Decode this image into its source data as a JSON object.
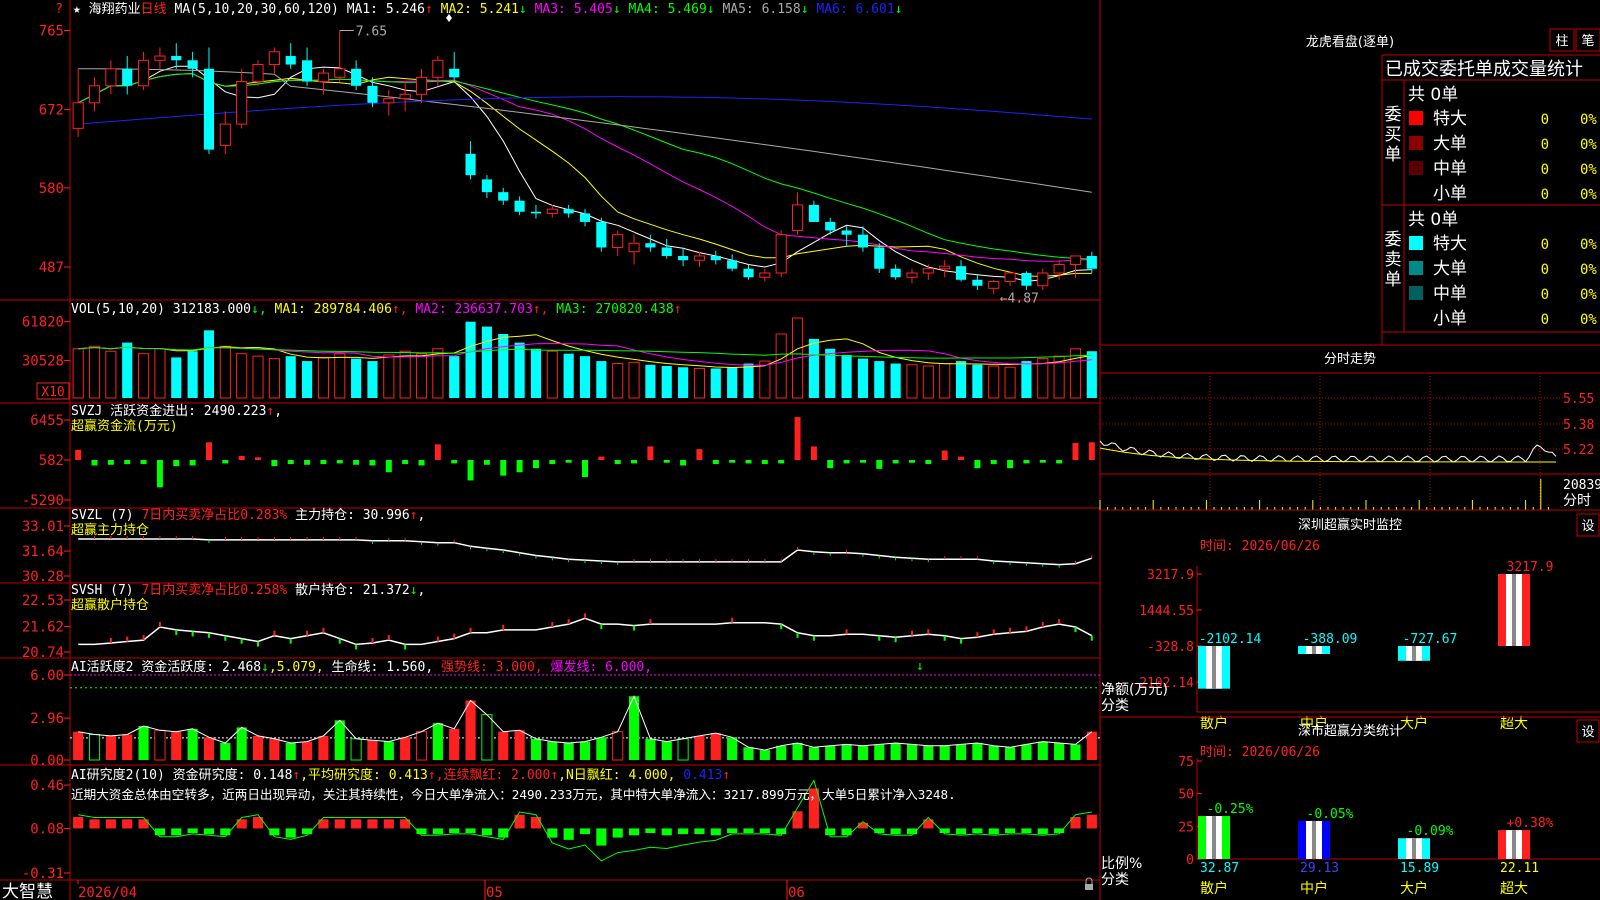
{
  "colors": {
    "bg": "#000000",
    "frame": "#c00000",
    "up": "#ff2020",
    "down": "#00ffff",
    "green": "#00ff00",
    "yellow": "#ffff00",
    "magenta": "#ff00ff",
    "blue": "#2020ff",
    "white": "#ffffff",
    "gray": "#aaaaaa"
  },
  "header": {
    "star": "★",
    "stock": "海翔药业",
    "period": "日线",
    "ma_params": "MA(5,10,20,30,60,120)",
    "ma_values": [
      {
        "label": "MA1: 5.246",
        "arrow": "↑",
        "color": "#ffffff"
      },
      {
        "label": "MA2: 5.241",
        "arrow": "↓",
        "color": "#ffff00"
      },
      {
        "label": "MA3: 5.405",
        "arrow": "↓",
        "color": "#ff00ff"
      },
      {
        "label": "MA4: 5.469",
        "arrow": "↓",
        "color": "#00ff00"
      },
      {
        "label": "MA5: 6.158",
        "arrow": "↓",
        "color": "#aaaaaa"
      },
      {
        "label": "MA6: 6.601",
        "arrow": "↓",
        "color": "#2020ff"
      }
    ],
    "top_question": "?"
  },
  "panels": {
    "price": {
      "ticks": [
        "765",
        "672",
        "580",
        "487"
      ],
      "high_label": "7.65",
      "low_label": "←4.87"
    },
    "vol": {
      "header": "VOL(5,10,20)",
      "v": "312183.000",
      "v_arrow": "↓",
      "ma1": "MA1: 289784.406",
      "ma1_arrow": "↑",
      "ma2": "MA2: 236637.703",
      "ma2_arrow": "↑",
      "ma3": "MA3: 270820.438",
      "ma3_arrow": "↑",
      "ticks": [
        "61820",
        "30528"
      ],
      "unit": "X10"
    },
    "svzj": {
      "header1": "SVZJ  活跃资金进出: 2490.223",
      "arrow": "↑",
      "comma": ",",
      "header2": "超赢资金流(万元)",
      "ticks": [
        "6455",
        "582",
        "-5290"
      ]
    },
    "svzl": {
      "p1": "SVZL (7)",
      "p2": "7日内买卖净占比0.283%",
      "p3": "主力持仓: 30.996",
      "arrow": "↑",
      "comma": ",",
      "header2": "超赢主力持仓",
      "ticks": [
        "33.01",
        "31.64",
        "30.28"
      ]
    },
    "svsh": {
      "p1": "SVSH (7)",
      "p2": "7日内买卖净占比0.258%",
      "p3": "散户持仓: 21.372",
      "arrow": "↓",
      "comma": ",",
      "header2": "超赢散户持仓",
      "ticks": [
        "22.53",
        "21.62",
        "20.74"
      ]
    },
    "ai2": {
      "p1": "AI活跃度2 资金活跃度: 2.468",
      "a1": "↓",
      "p2": ",5.079,",
      "p3": "生命线: 1.560,",
      "p4": "强势线: 3.000,",
      "p5": "爆发线: 6.000,",
      "ticks": [
        "6.00",
        "2.96",
        "0.00"
      ]
    },
    "ai_research": {
      "p1": "AI研究度2(10) 资金研究度: 0.148",
      "a1": "↑",
      "p2": ",平均研究度: 0.413",
      "a2": "↑",
      "p3": ",连续飘红: 2.000",
      "a3": "↑",
      "p4": ",N日飘红: 4.000,",
      "p5": "0.413",
      "a5": "↑",
      "comment": "近期大资金总体由空转多，近两日出现异动，关注其持续性，今日大单净流入：2490.233万元，其中特大单净流入：3217.899万元，大单5日累计净入3248.",
      "ticks": [
        "0.46",
        "0.08",
        "-0.31"
      ]
    }
  },
  "date_axis": [
    "2026/04",
    "05",
    "06"
  ],
  "brand": "大智慧",
  "right": {
    "lhb": {
      "title": "龙虎看盘(逐单)",
      "btn1": "柱",
      "btn2": "笔",
      "subtitle": "已成交委托单成交量统计",
      "buy": {
        "side": "委买单",
        "total": "共 0单",
        "rows": [
          {
            "name": "特大",
            "v": "0",
            "p": "0%",
            "c": "#ff0000"
          },
          {
            "name": "大单",
            "v": "0",
            "p": "0%",
            "c": "#8b0000"
          },
          {
            "name": "中单",
            "v": "0",
            "p": "0%",
            "c": "#5a0000"
          },
          {
            "name": "小单",
            "v": "0",
            "p": "0%",
            "c": "#000000"
          }
        ]
      },
      "sell": {
        "side": "委卖单",
        "total": "共 0单",
        "rows": [
          {
            "name": "特大",
            "v": "0",
            "p": "0%",
            "c": "#00ffff"
          },
          {
            "name": "大单",
            "v": "0",
            "p": "0%",
            "c": "#008b8b"
          },
          {
            "name": "中单",
            "v": "0",
            "p": "0%",
            "c": "#006060"
          },
          {
            "name": "小单",
            "v": "0",
            "p": "0%",
            "c": "#000000"
          }
        ]
      }
    },
    "fs": {
      "title": "分时走势",
      "ticks": [
        "5.55",
        "5.38",
        "5.22"
      ],
      "vol_tick": "20839",
      "vol_label": "分时"
    },
    "monitor": {
      "title": "深圳超赢实时监控",
      "btn": "设",
      "date": "时间: 2026/06/26",
      "ticks": [
        "3217.9",
        "1444.55",
        "-328.8",
        "-2102.14"
      ],
      "ylabel": "净额(万元)",
      "xlabel": "分类",
      "cats": [
        "散户",
        "中户",
        "大户",
        "超大"
      ],
      "values": [
        -2102.14,
        -388.09,
        -727.67,
        3217.9
      ],
      "value_labels": [
        "-2102.14",
        "-388.09",
        "-727.67",
        "3217.9"
      ]
    },
    "classify": {
      "title": "深市超赢分类统计",
      "btn": "设",
      "date": "时间: 2026/06/26",
      "ticks": [
        "75",
        "50",
        "25",
        "0"
      ],
      "ylabel": "比例%",
      "xlabel": "分类",
      "cats": [
        "散户",
        "中户",
        "大户",
        "超大"
      ],
      "values": [
        32.87,
        29.13,
        15.89,
        22.11
      ],
      "value_labels": [
        "32.87",
        "29.13",
        "15.89",
        "22.11"
      ],
      "changes": [
        "-0.25%",
        "-0.05%",
        "-0.09%",
        "+0.38%"
      ]
    }
  },
  "chart_data": [
    {
      "type": "candlestick",
      "title": "海翔药业 日线",
      "series_label": "MA(5,10,20,30,60,120)",
      "ohlc": [
        [
          6.5,
          7.2,
          6.4,
          6.8
        ],
        [
          6.8,
          7.1,
          6.7,
          7.0
        ],
        [
          7.0,
          7.3,
          6.9,
          7.2
        ],
        [
          7.2,
          7.35,
          6.9,
          7.0
        ],
        [
          7.0,
          7.4,
          6.95,
          7.3
        ],
        [
          7.3,
          7.45,
          7.2,
          7.35
        ],
        [
          7.35,
          7.5,
          7.2,
          7.3
        ],
        [
          7.3,
          7.4,
          7.1,
          7.2
        ],
        [
          7.2,
          7.45,
          6.2,
          6.25
        ],
        [
          6.3,
          6.7,
          6.2,
          6.55
        ],
        [
          6.55,
          7.2,
          6.5,
          7.05
        ],
        [
          7.05,
          7.3,
          7.0,
          7.25
        ],
        [
          7.25,
          7.45,
          7.15,
          7.4
        ],
        [
          7.35,
          7.5,
          7.2,
          7.25
        ],
        [
          7.3,
          7.45,
          7.0,
          7.05
        ],
        [
          7.05,
          7.2,
          6.9,
          7.15
        ],
        [
          7.1,
          7.65,
          7.05,
          7.2
        ],
        [
          7.2,
          7.3,
          6.95,
          7.0
        ],
        [
          7.0,
          7.1,
          6.75,
          6.8
        ],
        [
          6.8,
          6.95,
          6.65,
          6.85
        ],
        [
          6.85,
          7.05,
          6.7,
          6.9
        ],
        [
          6.9,
          7.2,
          6.8,
          7.1
        ],
        [
          7.1,
          7.35,
          7.0,
          7.3
        ],
        [
          7.2,
          7.4,
          7.05,
          7.1
        ],
        [
          6.2,
          6.35,
          5.9,
          5.95
        ],
        [
          5.9,
          5.95,
          5.68,
          5.75
        ],
        [
          5.75,
          5.8,
          5.6,
          5.65
        ],
        [
          5.65,
          5.7,
          5.48,
          5.52
        ],
        [
          5.52,
          5.6,
          5.44,
          5.5
        ],
        [
          5.5,
          5.6,
          5.45,
          5.55
        ],
        [
          5.55,
          5.6,
          5.45,
          5.5
        ],
        [
          5.5,
          5.55,
          5.35,
          5.4
        ],
        [
          5.4,
          5.45,
          5.05,
          5.1
        ],
        [
          5.1,
          5.3,
          5.0,
          5.25
        ],
        [
          5.05,
          5.25,
          4.9,
          5.15
        ],
        [
          5.15,
          5.25,
          5.05,
          5.1
        ],
        [
          5.1,
          5.2,
          4.97,
          5.0
        ],
        [
          5.0,
          5.1,
          4.88,
          4.95
        ],
        [
          4.95,
          5.05,
          4.87,
          5.0
        ],
        [
          5.0,
          5.06,
          4.9,
          4.95
        ],
        [
          4.95,
          5.02,
          4.82,
          4.85
        ],
        [
          4.85,
          4.9,
          4.72,
          4.75
        ],
        [
          4.75,
          4.85,
          4.7,
          4.8
        ],
        [
          4.8,
          5.3,
          4.75,
          5.25
        ],
        [
          5.3,
          5.75,
          5.25,
          5.6
        ],
        [
          5.6,
          5.65,
          5.4,
          5.4
        ],
        [
          5.4,
          5.45,
          5.25,
          5.3
        ],
        [
          5.3,
          5.35,
          5.12,
          5.25
        ],
        [
          5.25,
          5.35,
          5.05,
          5.1
        ],
        [
          5.1,
          5.15,
          4.8,
          4.85
        ],
        [
          4.85,
          4.9,
          4.72,
          4.75
        ],
        [
          4.75,
          4.85,
          4.68,
          4.8
        ],
        [
          4.8,
          4.9,
          4.72,
          4.85
        ],
        [
          4.85,
          4.95,
          4.75,
          4.88
        ],
        [
          4.88,
          4.95,
          4.7,
          4.72
        ],
        [
          4.72,
          4.78,
          4.6,
          4.65
        ],
        [
          4.62,
          4.72,
          4.55,
          4.7
        ],
        [
          4.7,
          4.82,
          4.65,
          4.8
        ],
        [
          4.8,
          4.82,
          4.6,
          4.65
        ],
        [
          4.65,
          4.85,
          4.6,
          4.8
        ],
        [
          4.8,
          4.95,
          4.72,
          4.9
        ],
        [
          4.9,
          5.0,
          4.74,
          5.0
        ],
        [
          5.0,
          5.05,
          4.8,
          4.85
        ]
      ],
      "ylim": [
        4.6,
        7.75
      ]
    },
    {
      "type": "bar",
      "name": "VOL",
      "values": [
        40,
        42,
        38,
        45,
        36,
        40,
        33,
        38,
        55,
        42,
        36,
        34,
        32,
        34,
        30,
        33,
        36,
        32,
        30,
        35,
        38,
        36,
        40,
        34,
        62,
        58,
        52,
        45,
        40,
        38,
        36,
        34,
        30,
        28,
        29,
        27,
        26,
        25,
        24,
        24,
        25,
        28,
        30,
        52,
        65,
        48,
        40,
        35,
        32,
        30,
        28,
        27,
        26,
        28,
        30,
        27,
        26,
        25,
        30,
        32,
        34,
        40,
        38
      ]
    },
    {
      "type": "bar",
      "name": "SVZJ",
      "values": [
        1.5,
        -0.8,
        -0.7,
        -0.6,
        -0.6,
        -4.0,
        -0.9,
        -0.8,
        2.6,
        -0.5,
        0.6,
        0.4,
        -0.9,
        -0.6,
        -0.7,
        -0.6,
        -0.5,
        -0.7,
        -0.8,
        -1.8,
        -0.6,
        -0.8,
        2.3,
        -0.5,
        -3.0,
        -0.7,
        -2.3,
        -1.8,
        -1.2,
        -0.6,
        -0.4,
        -2.5,
        0.5,
        -0.6,
        -0.5,
        2.0,
        -0.4,
        -0.8,
        1.6,
        -0.6,
        -0.4,
        -0.5,
        -0.6,
        -0.5,
        6.3,
        2.0,
        -1.2,
        -0.5,
        -0.4,
        -1.3,
        -0.5,
        -0.4,
        -0.6,
        1.4,
        0.5,
        -1.2,
        -0.6,
        -1.2,
        -0.5,
        -0.4,
        -0.5,
        2.5,
        2.6
      ]
    },
    {
      "type": "line",
      "name": "SVZL",
      "values": [
        32.3,
        32.3,
        32.3,
        32.3,
        32.3,
        32.3,
        32.3,
        32.3,
        32.25,
        32.25,
        32.25,
        32.25,
        32.25,
        32.25,
        32.25,
        32.25,
        32.25,
        32.25,
        32.2,
        32.2,
        32.2,
        32.15,
        32.1,
        32.1,
        31.9,
        31.8,
        31.7,
        31.55,
        31.4,
        31.3,
        31.2,
        31.15,
        31.1,
        31.05,
        31.05,
        31.05,
        31.05,
        31.05,
        31.05,
        31.05,
        31.05,
        31.05,
        31.05,
        31.05,
        31.7,
        31.6,
        31.55,
        31.55,
        31.5,
        31.4,
        31.3,
        31.25,
        31.2,
        31.2,
        31.2,
        31.2,
        31.1,
        31.05,
        31.0,
        30.95,
        30.9,
        30.95,
        31.25
      ]
    },
    {
      "type": "line",
      "name": "SVSH",
      "values": [
        21.0,
        21.0,
        21.05,
        21.1,
        21.15,
        21.6,
        21.5,
        21.45,
        21.4,
        21.3,
        21.2,
        21.1,
        21.3,
        21.2,
        21.3,
        21.4,
        21.2,
        21.0,
        21.05,
        21.15,
        21.0,
        21.0,
        21.1,
        21.2,
        21.4,
        21.4,
        21.5,
        21.5,
        21.5,
        21.6,
        21.7,
        21.9,
        21.7,
        21.7,
        21.65,
        21.7,
        21.7,
        21.7,
        21.7,
        21.7,
        21.75,
        21.75,
        21.75,
        21.7,
        21.4,
        21.3,
        21.3,
        21.35,
        21.35,
        21.3,
        21.25,
        21.3,
        21.35,
        21.3,
        21.2,
        21.25,
        21.35,
        21.4,
        21.45,
        21.6,
        21.7,
        21.6,
        21.3
      ]
    },
    {
      "type": "bar",
      "name": "AI活跃度2",
      "values": [
        2.0,
        1.8,
        1.7,
        1.8,
        2.4,
        2.1,
        2.0,
        2.2,
        1.6,
        1.2,
        2.3,
        1.7,
        1.5,
        1.2,
        1.3,
        1.7,
        2.8,
        1.5,
        1.4,
        1.3,
        1.6,
        2.0,
        2.6,
        2.2,
        4.2,
        3.2,
        2.0,
        2.1,
        1.5,
        1.3,
        1.2,
        1.3,
        1.6,
        2.0,
        4.5,
        1.5,
        1.3,
        1.5,
        1.7,
        1.9,
        1.6,
        0.9,
        0.7,
        1.0,
        1.2,
        0.9,
        1.0,
        1.1,
        1.0,
        1.1,
        1.2,
        1.1,
        1.0,
        1.0,
        1.1,
        1.2,
        1.0,
        0.9,
        1.1,
        1.3,
        1.2,
        1.1,
        2.0
      ]
    },
    {
      "type": "bar",
      "name": "AI研究度2",
      "values": [
        0.1,
        0.08,
        0.08,
        0.08,
        0.08,
        -0.06,
        -0.06,
        -0.04,
        -0.05,
        -0.06,
        0.08,
        0.1,
        -0.06,
        -0.08,
        -0.05,
        0.08,
        0.08,
        0.08,
        0.08,
        0.08,
        0.08,
        -0.05,
        -0.05,
        -0.04,
        -0.04,
        -0.06,
        -0.08,
        0.12,
        0.1,
        -0.08,
        -0.1,
        -0.05,
        -0.15,
        -0.08,
        -0.06,
        -0.04,
        -0.06,
        -0.05,
        -0.05,
        -0.06,
        -0.04,
        -0.04,
        -0.04,
        -0.05,
        0.15,
        0.35,
        -0.06,
        -0.06,
        0.05,
        -0.04,
        -0.05,
        -0.05,
        0.08,
        -0.04,
        -0.05,
        -0.04,
        -0.05,
        -0.04,
        -0.04,
        -0.05,
        -0.04,
        0.1,
        0.12
      ]
    }
  ]
}
